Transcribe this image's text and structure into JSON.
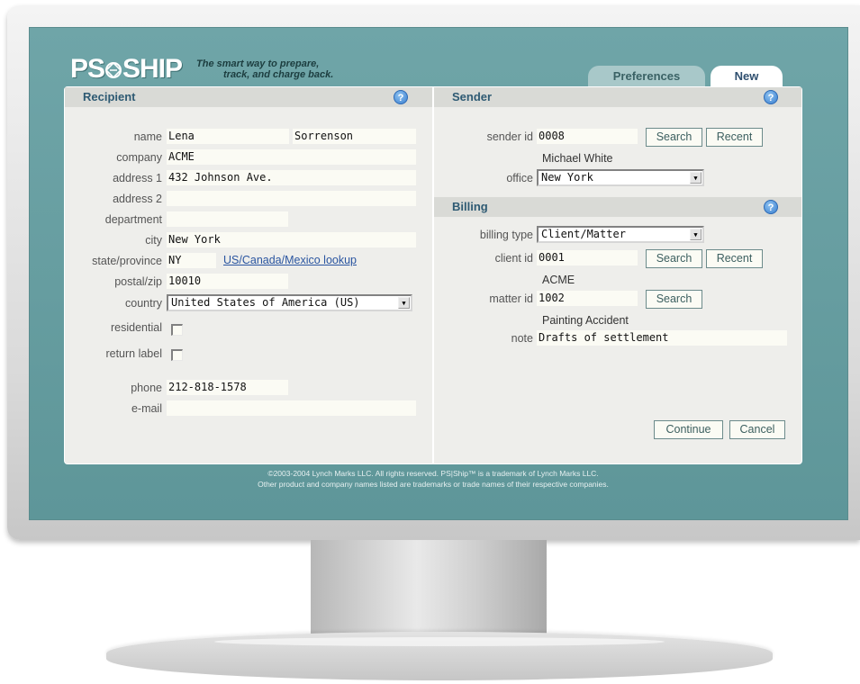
{
  "app": {
    "logo_text": "PS",
    "logo_text_2": "SHIP",
    "tagline_line1": "The smart way to prepare,",
    "tagline_line2": "track, and charge back."
  },
  "tabs": [
    {
      "label": "Preferences",
      "active": false
    },
    {
      "label": "New",
      "active": true
    }
  ],
  "recipient": {
    "title": "Recipient",
    "help": "?",
    "fields": {
      "name_label": "name",
      "first_name": "Lena",
      "last_name": "Sorrenson",
      "company_label": "company",
      "company": "ACME",
      "address1_label": "address 1",
      "address1": "432 Johnson Ave.",
      "address2_label": "address 2",
      "address2": "",
      "department_label": "department",
      "department": "",
      "city_label": "city",
      "city": "New York",
      "state_label": "state/province",
      "state": "NY",
      "lookup_link": "US/Canada/Mexico lookup",
      "postal_label": "postal/zip",
      "postal": "10010",
      "country_label": "country",
      "country": "United States of America (US)",
      "residential_label": "residential",
      "residential_checked": false,
      "return_label_label": "return label",
      "return_label_checked": false,
      "phone_label": "phone",
      "phone": "212-818-1578",
      "email_label": "e-mail",
      "email": ""
    }
  },
  "sender": {
    "title": "Sender",
    "help": "?",
    "sender_id_label": "sender id",
    "sender_id": "0008",
    "search_label": "Search",
    "recent_label": "Recent",
    "sender_name": "Michael White",
    "office_label": "office",
    "office": "New York"
  },
  "billing": {
    "title": "Billing",
    "help": "?",
    "billing_type_label": "billing type",
    "billing_type": "Client/Matter",
    "client_id_label": "client id",
    "client_id": "0001",
    "client_search_label": "Search",
    "client_recent_label": "Recent",
    "client_name": "ACME",
    "matter_id_label": "matter id",
    "matter_id": "1002",
    "matter_search_label": "Search",
    "matter_name": "Painting Accident",
    "note_label": "note",
    "note": "Drafts of settlement"
  },
  "actions": {
    "continue_label": "Continue",
    "cancel_label": "Cancel"
  },
  "footer": {
    "line1": "©2003-2004 Lynch Marks LLC. All rights reserved. PS|Ship™ is a trademark of Lynch Marks LLC.",
    "line2": "Other product and company names listed are trademarks or trade names of their respective companies."
  },
  "colors": {
    "screen_bg": "#5e9699",
    "panel_bg": "#eeeeeb",
    "header_text": "#2e5a73",
    "link": "#2a55a0"
  },
  "icons": {
    "help": "help-icon",
    "dropdown": "chevron-down-icon",
    "logo": "globe-icon"
  }
}
